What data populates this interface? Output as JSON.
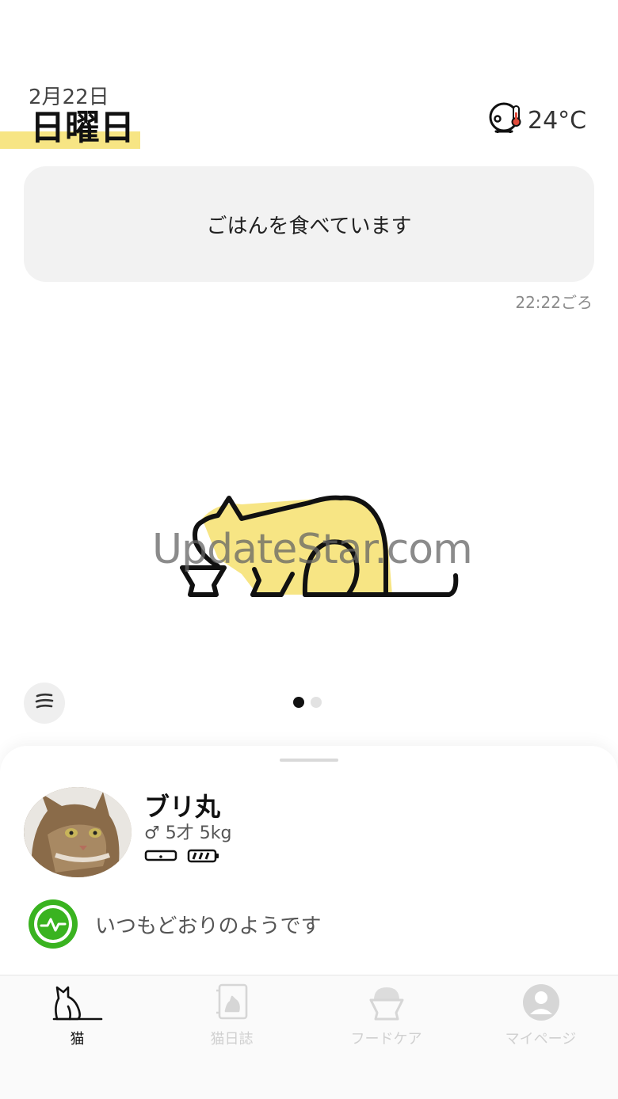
{
  "header": {
    "date": "2月22日",
    "weekday": "日曜日",
    "temperature": "24°C",
    "temperature_icon": "thermometer-device-icon"
  },
  "status": {
    "message": "ごはんを食べています",
    "time": "22:22ごろ"
  },
  "watermark": "UpdateStar.com",
  "pager": {
    "pages": 2,
    "current": 1
  },
  "cat": {
    "name": "ブリ丸",
    "meta": "♂ 5才 5kg",
    "health_message": "いつもどおりのようです"
  },
  "tabs": [
    {
      "label": "猫",
      "icon": "cat-icon",
      "active": true
    },
    {
      "label": "猫日誌",
      "icon": "diary-icon",
      "active": false
    },
    {
      "label": "フードケア",
      "icon": "food-bowl-icon",
      "active": false
    },
    {
      "label": "マイページ",
      "icon": "person-icon",
      "active": false
    }
  ],
  "colors": {
    "accent_yellow": "#f7e584",
    "health_green": "#3ab320",
    "card_bg": "#f2f2f2"
  }
}
